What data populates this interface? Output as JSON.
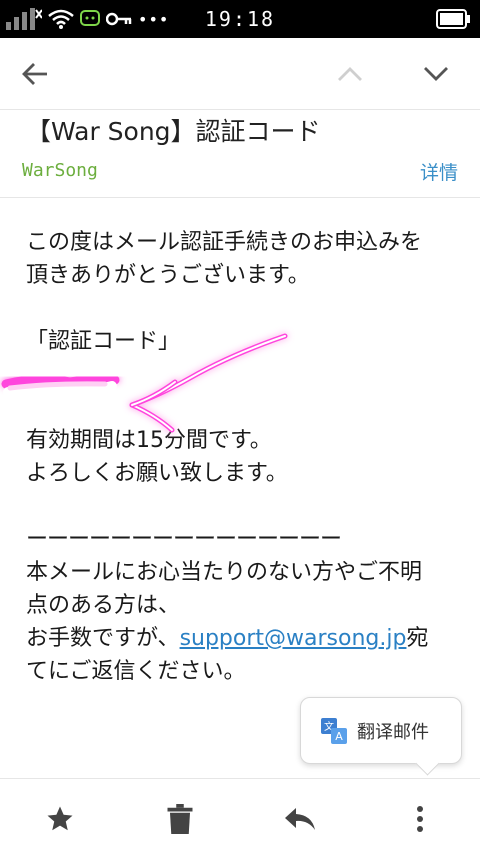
{
  "status_bar": {
    "time": "19:18",
    "dots": "•••"
  },
  "email": {
    "subject": "【War Song】認証コード",
    "sender": "WarSong",
    "details_label": "详情",
    "body": {
      "line1": "この度はメール認証手続きのお申込みを",
      "line2": "頂きありがとうございます。",
      "code_heading": "「認証コード」",
      "validity": "有効期間は15分間です。",
      "regards": "よろしくお願い致します。",
      "separator": "ーーーーーーーーーーーーーーー",
      "notice1": "本メールにお心当たりのない方やご不明",
      "notice2": "点のある方は、",
      "notice3_prefix": "お手数ですが、",
      "support_email": "support@warsong.jp",
      "notice3_suffix": "宛",
      "notice4": "てにご返信ください。"
    }
  },
  "translate_popup": {
    "label": "翻译邮件"
  },
  "colors": {
    "sender": "#6cae3e",
    "link": "#2a80c4",
    "annotation": "#ff44dd"
  }
}
